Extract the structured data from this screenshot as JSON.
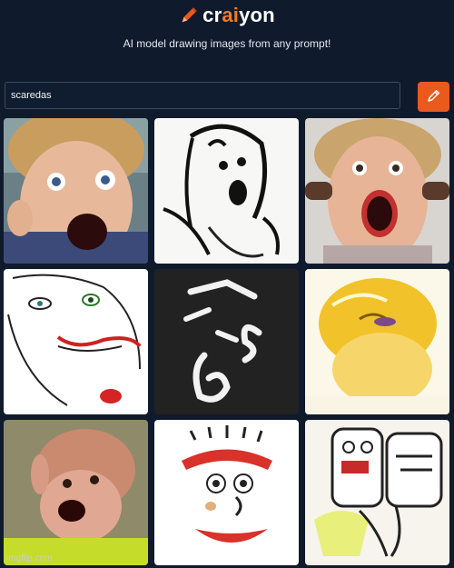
{
  "app": {
    "logo_prefix": "cr",
    "logo_ai": "ai",
    "logo_suffix": "yon",
    "tagline": "AI model drawing images from any prompt!",
    "accent_color": "#ea5a1d",
    "logo_icon": "pencil-icon"
  },
  "search": {
    "value": "scaredas",
    "button_icon": "pencil-icon"
  },
  "results": {
    "images": [
      {
        "icon": "screaming-child-photo"
      },
      {
        "icon": "screaming-sketch"
      },
      {
        "icon": "screaming-girl-photo"
      },
      {
        "icon": "scared-face-sketch"
      },
      {
        "icon": "abstract-strokes-dark"
      },
      {
        "icon": "yellow-face-painting"
      },
      {
        "icon": "screaming-baby-photo"
      },
      {
        "icon": "clown-face-sketch"
      },
      {
        "icon": "two-figures-drawing"
      }
    ]
  },
  "watermark": "imgflip.com"
}
